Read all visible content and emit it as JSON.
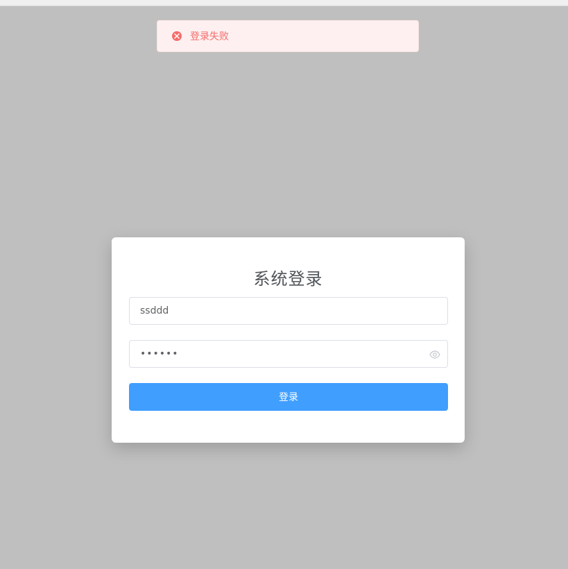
{
  "toast": {
    "icon": "close-circle-icon",
    "message": "登录失败",
    "color": "#f56c6c"
  },
  "login": {
    "title": "系统登录",
    "username_value": "ssddd",
    "password_masked": "••••••",
    "password_toggle_icon": "eye-icon",
    "submit_label": "登录",
    "submit_color": "#409eff"
  }
}
